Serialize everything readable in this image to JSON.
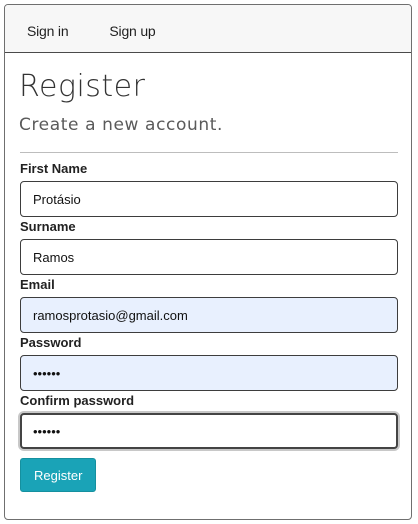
{
  "nav": {
    "items": [
      {
        "label": "Sign in"
      },
      {
        "label": "Sign up"
      }
    ]
  },
  "header": {
    "title": "Register",
    "subtitle": "Create a new account."
  },
  "form": {
    "first_name": {
      "label": "First Name",
      "value": "Protásio"
    },
    "surname": {
      "label": "Surname",
      "value": "Ramos"
    },
    "email": {
      "label": "Email",
      "value": "ramosprotasio@gmail.com"
    },
    "password": {
      "label": "Password",
      "value": "••••••"
    },
    "confirm_password": {
      "label": "Confirm password",
      "value": "••••••"
    },
    "submit_label": "Register"
  },
  "colors": {
    "accent": "#1aa3b7",
    "autofill_bg": "#e8f0fe",
    "navbar_bg": "#f7f7f7"
  }
}
